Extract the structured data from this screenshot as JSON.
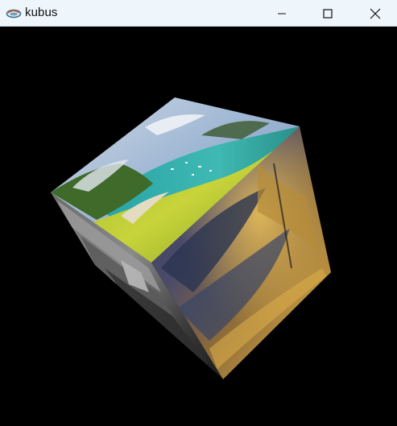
{
  "window": {
    "title": "kubus",
    "app_icon": "java-coffee-cup-icon",
    "controls": {
      "minimize_icon": "minimize-icon",
      "maximize_icon": "maximize-icon",
      "close_icon": "close-icon"
    }
  },
  "scene": {
    "background_color": "#000000",
    "object": "textured-cube",
    "faces": {
      "top": "coastal-bay-landscape",
      "front": "sunset-clouds-over-water",
      "left": "grayscale-landscape"
    }
  }
}
